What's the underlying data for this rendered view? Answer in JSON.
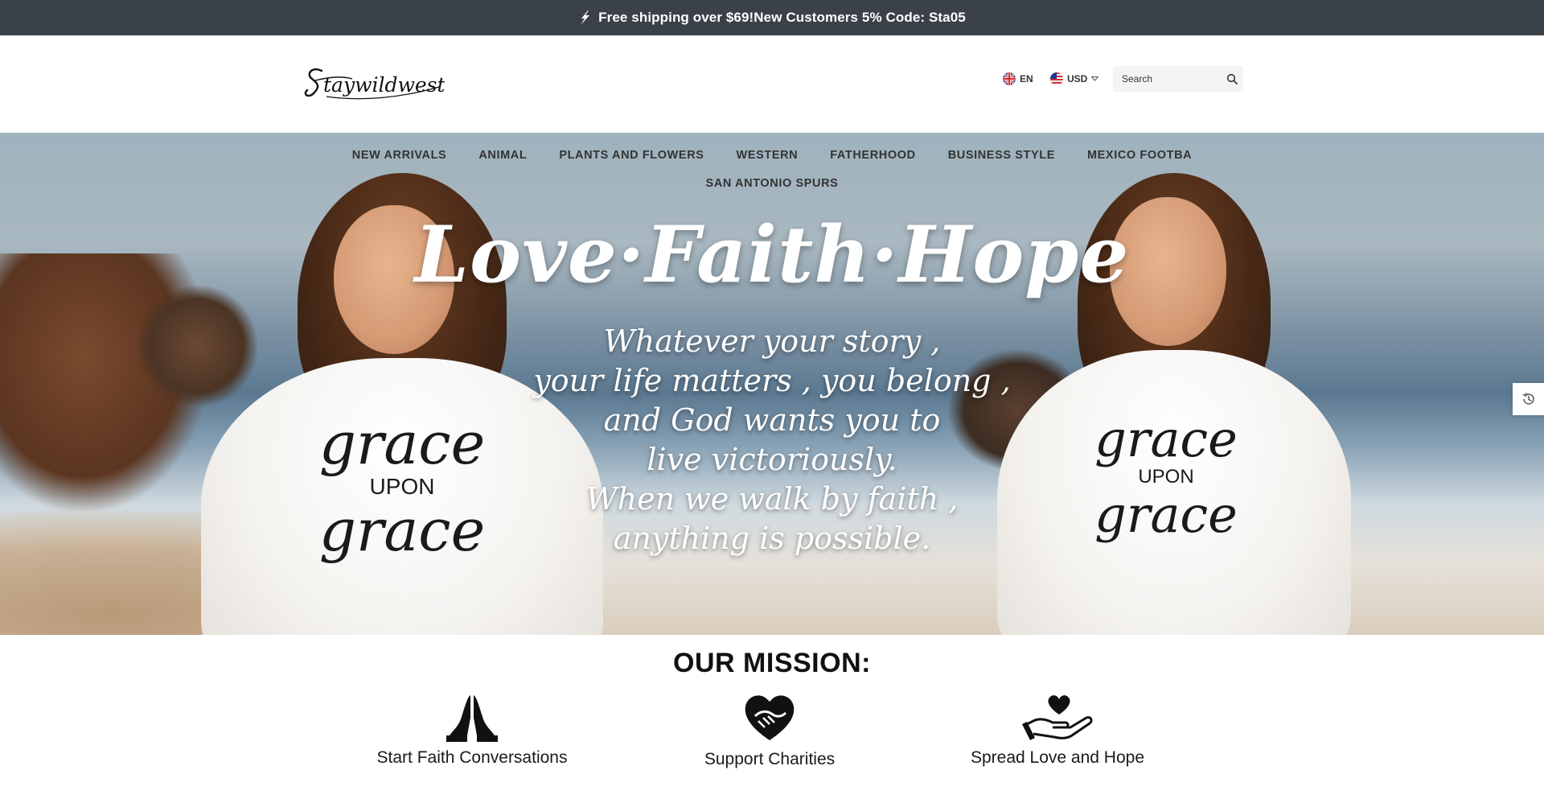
{
  "announcement": {
    "icon": "lightning-bolt-icon",
    "text": "Free shipping over $69!New Customers 5% Code: Sta05"
  },
  "header": {
    "logo_text": "Staywildwest",
    "language": {
      "code": "EN",
      "icon": "uk-flag-icon"
    },
    "currency": {
      "code": "USD",
      "icon": "us-flag-icon"
    },
    "search": {
      "placeholder": "Search",
      "icon": "search-icon"
    }
  },
  "nav": {
    "items": [
      {
        "label": "NEW ARRIVALS"
      },
      {
        "label": "ANIMAL"
      },
      {
        "label": "PLANTS AND FLOWERS"
      },
      {
        "label": "WESTERN"
      },
      {
        "label": "FATHERHOOD"
      },
      {
        "label": "BUSINESS STYLE"
      },
      {
        "label": "MEXICO FOOTBA"
      }
    ],
    "second_row": [
      {
        "label": "SAN ANTONIO SPURS"
      }
    ]
  },
  "hero": {
    "headline": "Love·Faith·Hope",
    "quote_lines": [
      "Whatever your story ,",
      "your life matters , you belong ,",
      "and God wants you to",
      "live victoriously.",
      "When we walk by faith ,",
      "anything is possible."
    ],
    "shirt_text": {
      "top": "grace",
      "middle": "UPON",
      "bottom": "grace"
    }
  },
  "recent_widget": {
    "icon": "history-icon"
  },
  "mission": {
    "title": "OUR MISSION:",
    "items": [
      {
        "label": "Start Faith Conversations",
        "icon": "praying-hands-icon"
      },
      {
        "label": "Support Charities",
        "icon": "heart-handshake-icon"
      },
      {
        "label": "Spread Love and Hope",
        "icon": "hand-heart-icon"
      }
    ]
  },
  "colors": {
    "announcement_bg": "#3b4148",
    "announcement_text": "#ffffff",
    "nav_text": "#333333",
    "search_bg": "#f4f4f4"
  }
}
